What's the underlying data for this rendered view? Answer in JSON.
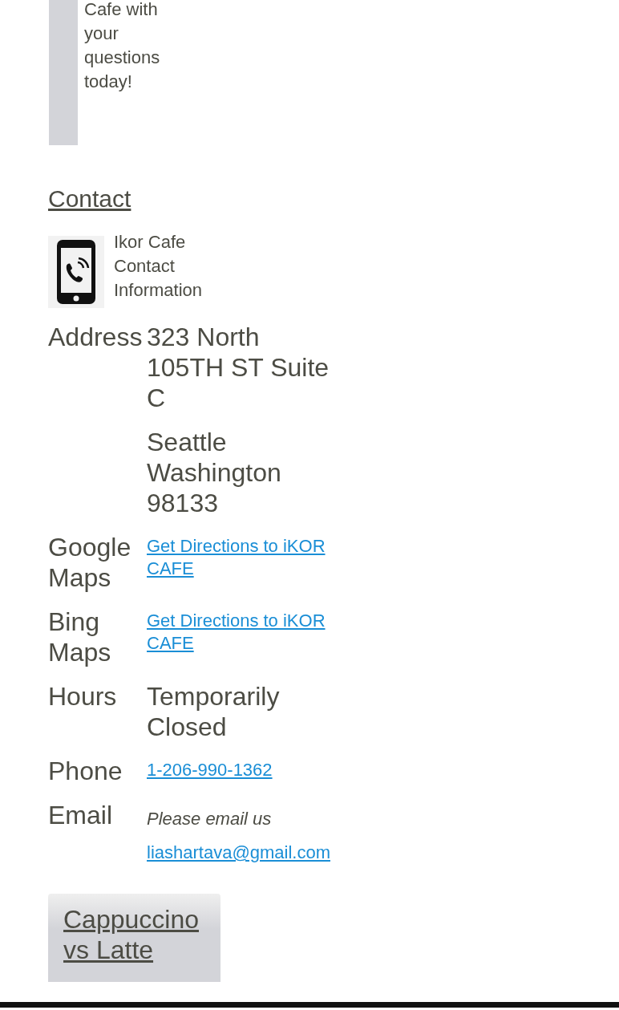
{
  "intro": {
    "text": "Cafe with your questions today!"
  },
  "contact": {
    "heading": "Contact",
    "caption": "Ikor Cafe Contact Information",
    "rows": [
      {
        "label": "Address",
        "values": [
          {
            "kind": "text",
            "text": "323 North 105TH ST Suite C"
          },
          {
            "kind": "text",
            "text": "Seattle Washington 98133"
          }
        ]
      },
      {
        "label": "Google Maps",
        "values": [
          {
            "kind": "link",
            "text": "Get Directions to iKOR CAFE"
          }
        ]
      },
      {
        "label": "Bing Maps",
        "values": [
          {
            "kind": "link",
            "text": "Get Directions to iKOR CAFE"
          }
        ]
      },
      {
        "label": "Hours",
        "values": [
          {
            "kind": "text",
            "text": "Temporarily Closed"
          }
        ]
      },
      {
        "label": "Phone",
        "values": [
          {
            "kind": "link",
            "text": "1-206-990-1362"
          }
        ]
      },
      {
        "label": "Email",
        "values": [
          {
            "kind": "note",
            "text": "Please email us"
          },
          {
            "kind": "link",
            "text": "liashartava@gmail.com"
          }
        ]
      }
    ]
  },
  "article": {
    "title": "Cappuccino vs Latte"
  }
}
